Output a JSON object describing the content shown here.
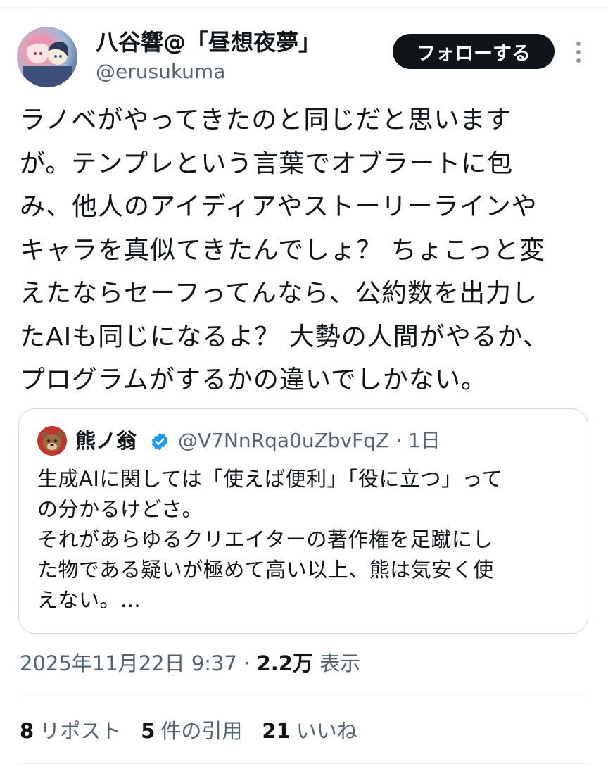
{
  "author": {
    "display_name": "八谷響@「昼想夜夢」",
    "handle": "@erusukuma",
    "follow_label": "フォローする",
    "avatar": "anime-illustration-avatar"
  },
  "tweet": {
    "lines": [
      "ラノベがやってきたのと同じだと思います",
      "が。テンプレという言葉でオブラートに包",
      "み、他人のアイディアやストーリーラインや",
      "キャラを真似てきたんでしょ？ ちょこっと変",
      "えたならセーフってんなら、公約数を出力し",
      "たAIも同じになるよ？ 大勢の人間がやるか、",
      "プログラムがするかの違いでしかない。"
    ]
  },
  "quote": {
    "display_name": "熊ノ翁",
    "verified": true,
    "handle": "@V7NnRqa0uZbvFqZ · 1日",
    "avatar": "bear-avatar",
    "lines": [
      "生成AIに関しては「使えば便利」「役に立つ」って",
      "の分かるけどさ。",
      "それがあらゆるクリエイターの著作権を足蹴にし",
      "た物である疑いが極めて高い以上、熊は気安く使",
      "えない。..."
    ]
  },
  "meta": {
    "timestamp": "2025年11月22日 9:37 · ",
    "views_count": "2.2万",
    "views_label": " 表示"
  },
  "stats": {
    "reposts_count": "8",
    "reposts_label": "リポスト",
    "quotes_count": "5",
    "quotes_label": "件の引用",
    "likes_count": "21",
    "likes_label": "いいね"
  },
  "colors": {
    "text": "#0f1419",
    "secondary": "#536471",
    "border": "#cfd9de",
    "verified": "#1d9bf0",
    "button_bg": "#0f1419"
  }
}
